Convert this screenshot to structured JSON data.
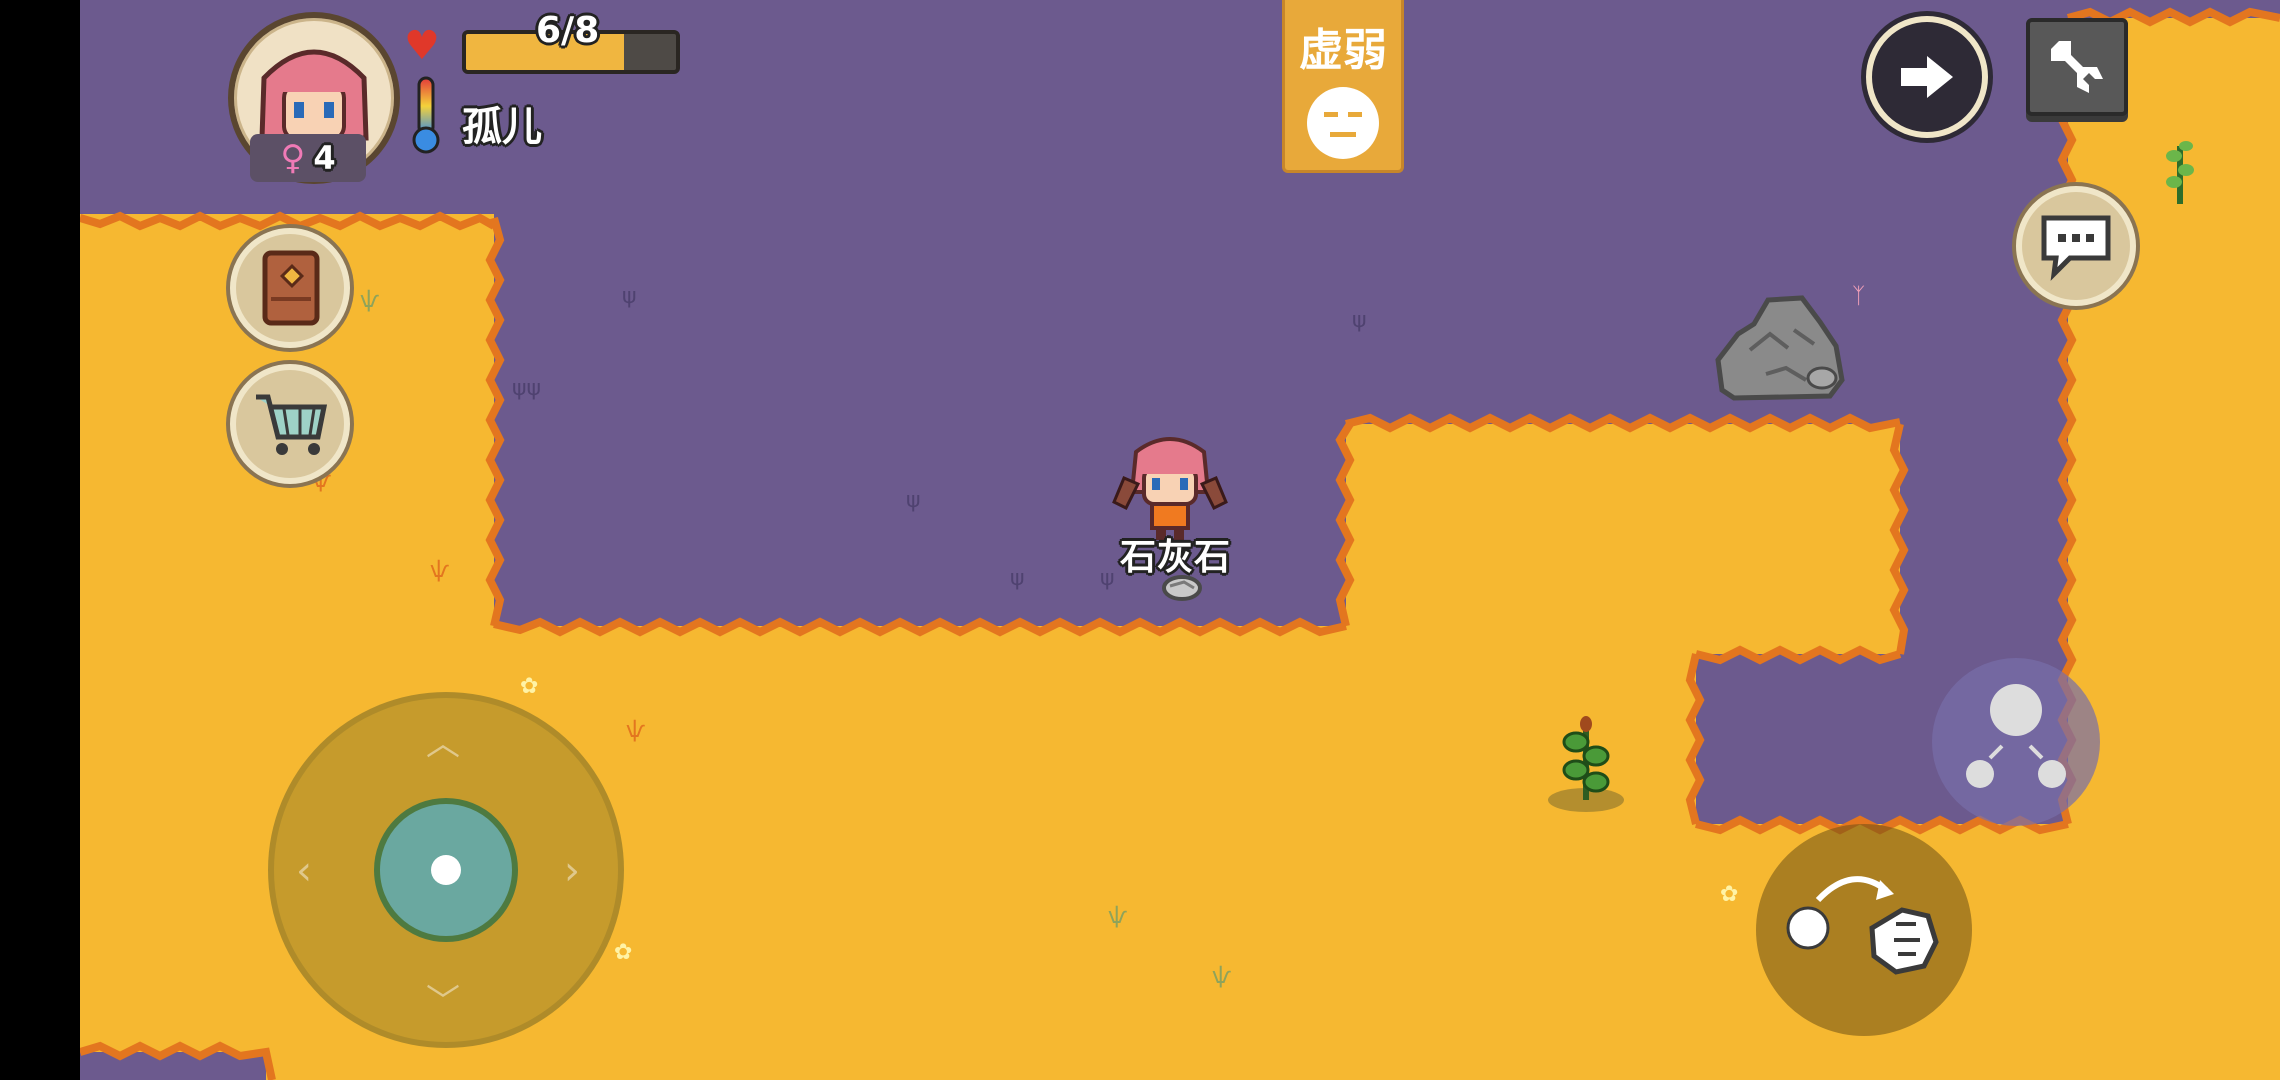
{
  "player": {
    "health_text": "6/8",
    "health_fraction": 0.75,
    "status_name": "孤儿",
    "gender_symbol": "♀",
    "age": "4"
  },
  "status_banner": {
    "label": "虚弱",
    "face_icon": "neutral-face-icon"
  },
  "item_label": "石灰石",
  "icons": {
    "heart": "heart-icon",
    "thermometer": "thermometer-icon",
    "book": "recipe-book-icon",
    "shop": "shopping-cart-icon",
    "exit": "arrow-right-icon",
    "settings": "wrench-icon",
    "chat": "chat-bubble-icon",
    "joystick": "joystick",
    "throw": "throw-hand-icon",
    "emote": "emote-icon"
  },
  "colors": {
    "ground_yellow": "#f6b831",
    "ground_purple": "#6c5a8e",
    "edge_orange": "#e3761f",
    "health_fill": "#f0b640",
    "banner": "#e8a93a"
  }
}
